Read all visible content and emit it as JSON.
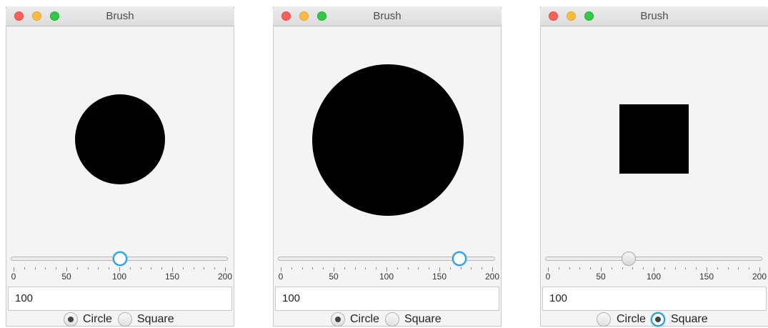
{
  "windows": [
    {
      "title": "Brush",
      "shape": "circle",
      "slider": {
        "value": 100,
        "min": 0,
        "max": 200,
        "focused": true,
        "tick_labels": [
          "0",
          "50",
          "100",
          "150",
          "200"
        ]
      },
      "text_field_value": "100",
      "radios": [
        {
          "label": "Circle",
          "selected": true
        },
        {
          "label": "Square",
          "selected": false
        }
      ]
    },
    {
      "title": "Brush",
      "shape": "circle",
      "slider": {
        "value": 168,
        "min": 0,
        "max": 200,
        "focused": true,
        "tick_labels": [
          "0",
          "50",
          "100",
          "150",
          "200"
        ]
      },
      "text_field_value": "100",
      "radios": [
        {
          "label": "Circle",
          "selected": true
        },
        {
          "label": "Square",
          "selected": false
        }
      ]
    },
    {
      "title": "Brush",
      "shape": "square",
      "slider": {
        "value": 75,
        "min": 0,
        "max": 200,
        "focused": false,
        "tick_labels": [
          "0",
          "50",
          "100",
          "150",
          "200"
        ]
      },
      "text_field_value": "100",
      "radios": [
        {
          "label": "Circle",
          "selected": false
        },
        {
          "label": "Square",
          "selected": true
        }
      ]
    }
  ],
  "colors": {
    "shape": "#000000",
    "focus_ring": "#2c9fdc",
    "close": "#fc605c",
    "minimize": "#fdbc40",
    "maximize": "#34c84a"
  },
  "icons": {
    "close": "close-traffic-light-icon",
    "minimize": "minimize-traffic-light-icon",
    "maximize": "maximize-traffic-light-icon"
  }
}
